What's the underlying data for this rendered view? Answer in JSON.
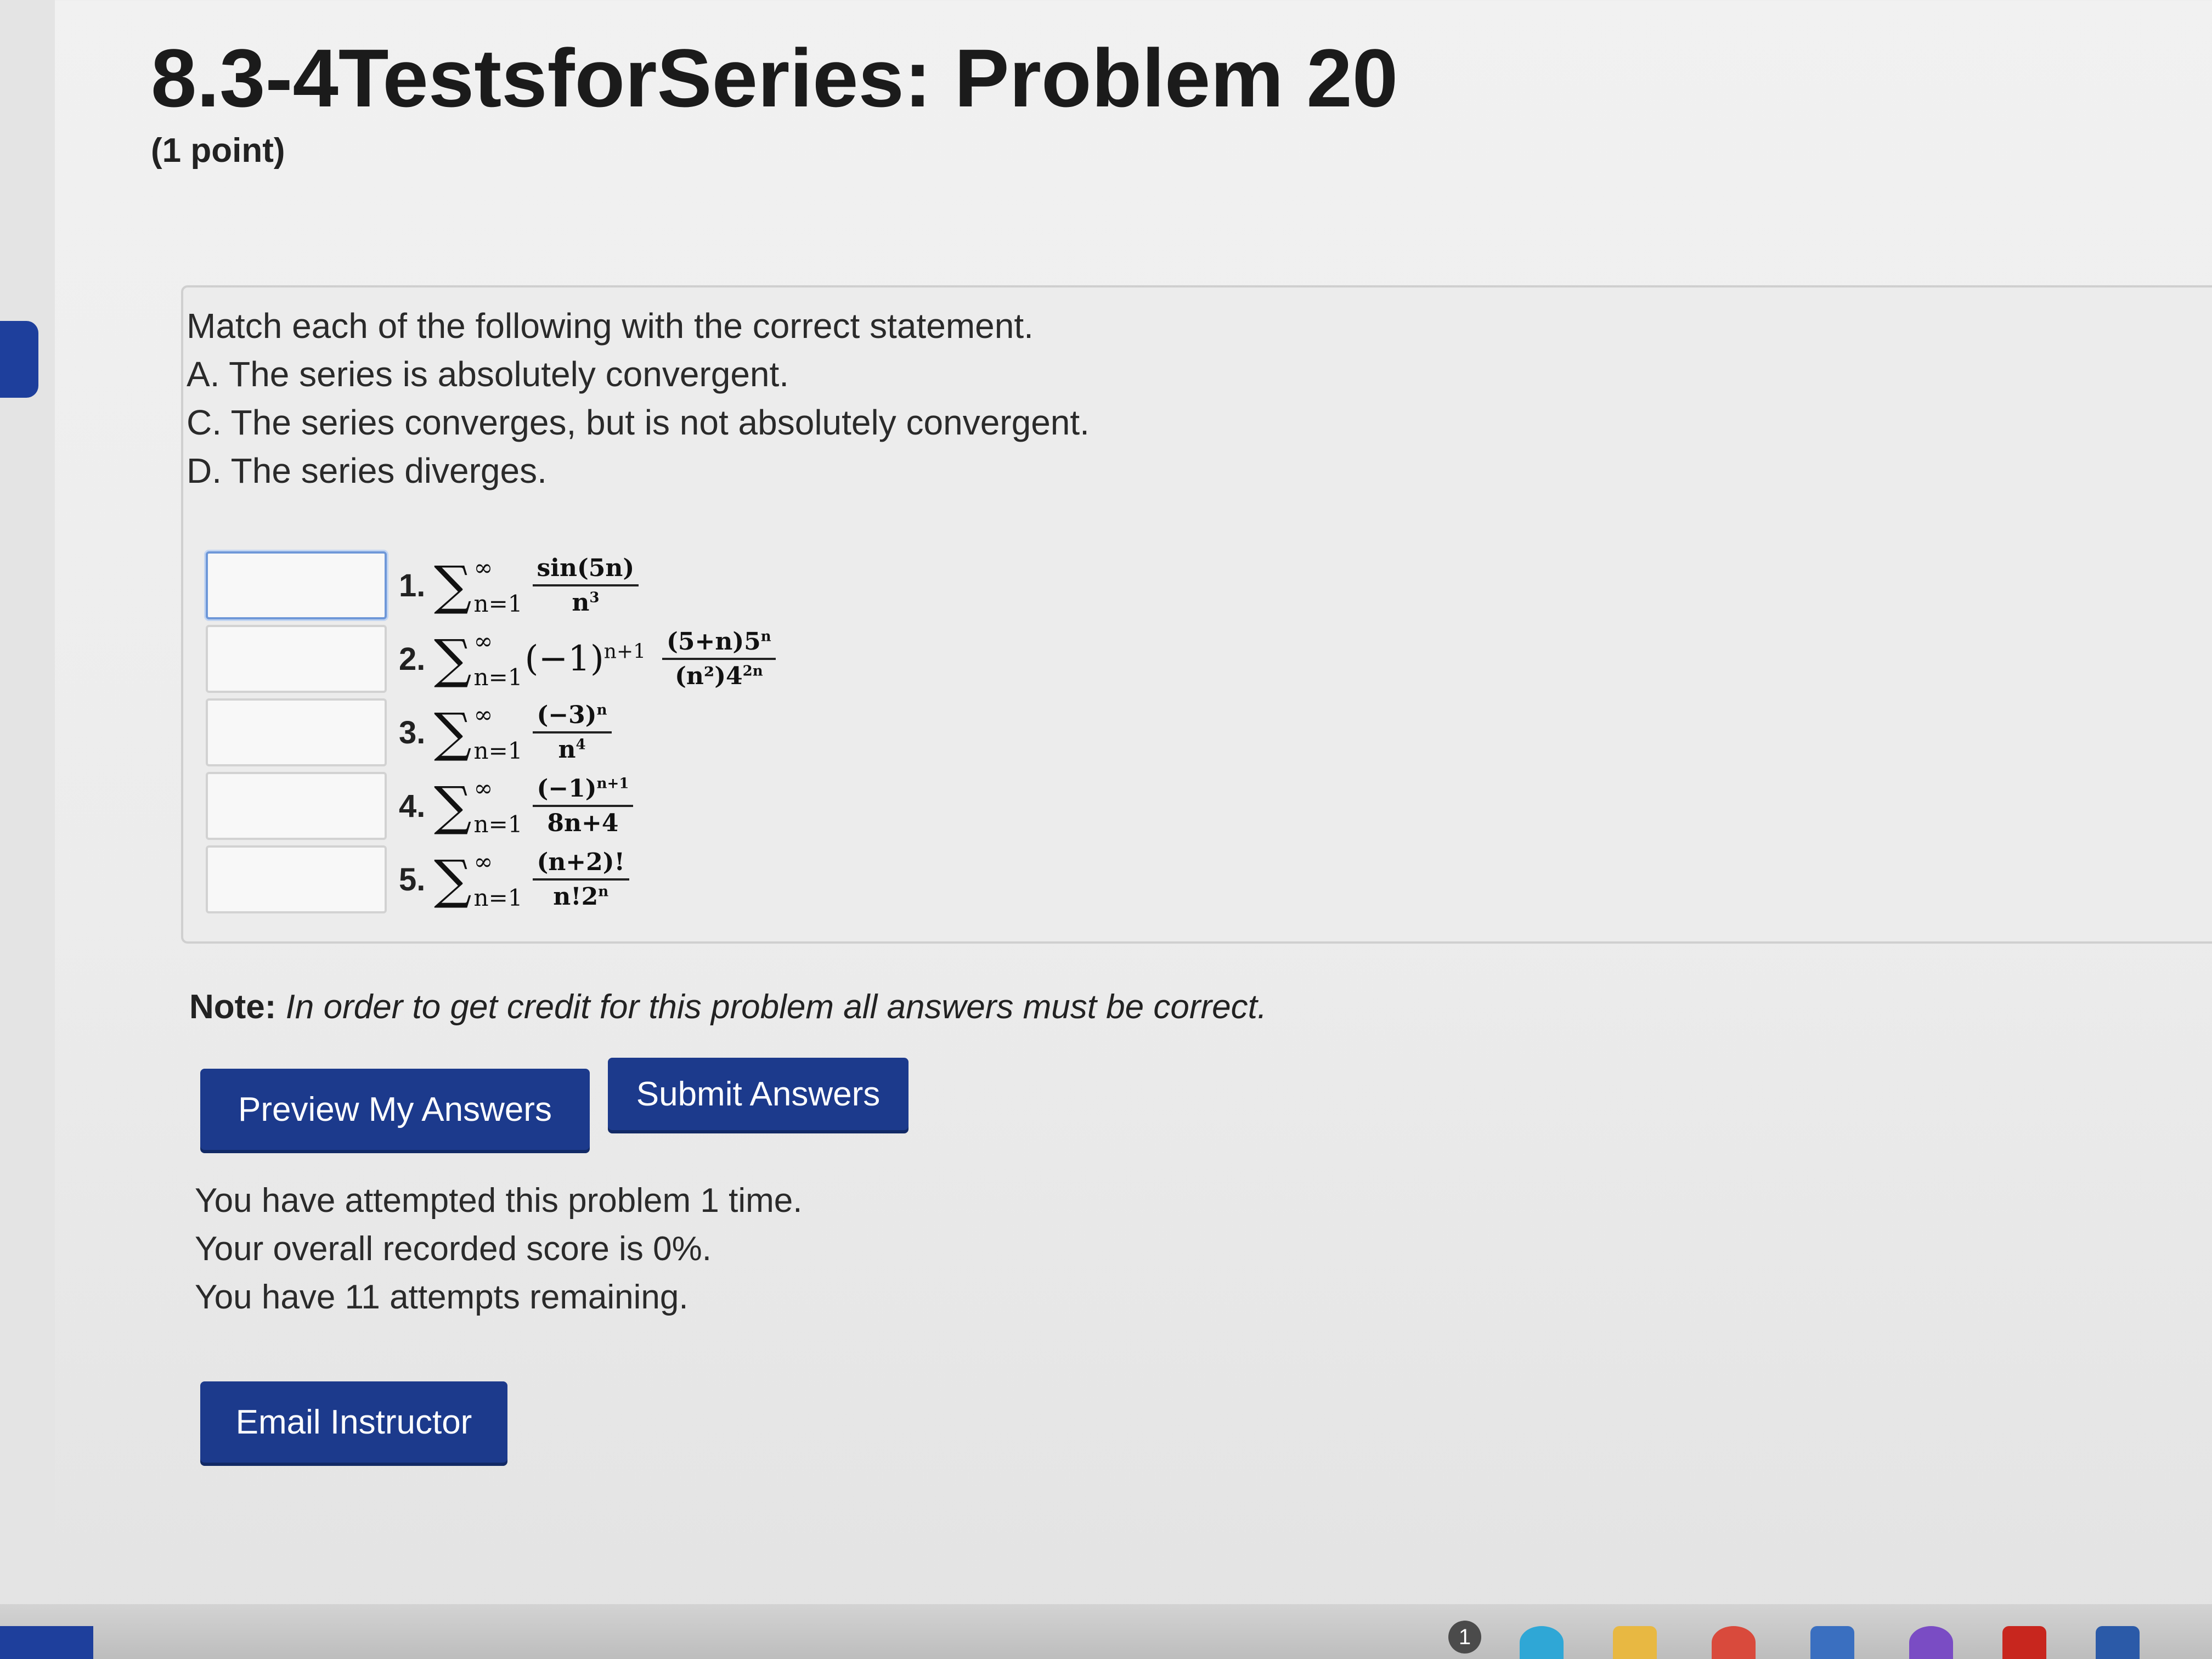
{
  "header": {
    "title": "8.3-4TestsforSeries: Problem 20",
    "points": "(1 point)"
  },
  "instructions": {
    "prompt": "Match each of the following with the correct statement.",
    "options": [
      "A. The series is absolutely convergent.",
      "C. The series converges, but is not absolutely convergent.",
      "D. The series diverges."
    ]
  },
  "problems": [
    {
      "number": "1.",
      "value": "",
      "sigma": "∑",
      "sup": "∞",
      "sub": "n=1",
      "factor": "",
      "factor_exp": "",
      "numerator": "sin(5n)",
      "num_exp": "",
      "denominator": "n",
      "den_exp": "3"
    },
    {
      "number": "2.",
      "value": "",
      "sigma": "∑",
      "sup": "∞",
      "sub": "n=1",
      "factor": "(−1)",
      "factor_exp": "n+1",
      "numerator": "(5+n)5",
      "num_exp": "n",
      "denominator": "(n²)4",
      "den_exp": "2n"
    },
    {
      "number": "3.",
      "value": "",
      "sigma": "∑",
      "sup": "∞",
      "sub": "n=1",
      "factor": "",
      "factor_exp": "",
      "numerator": "(−3)",
      "num_exp": "n",
      "denominator": "n",
      "den_exp": "4"
    },
    {
      "number": "4.",
      "value": "",
      "sigma": "∑",
      "sup": "∞",
      "sub": "n=1",
      "factor": "",
      "factor_exp": "",
      "numerator": "(−1)",
      "num_exp": "n+1",
      "denominator": "8n+4",
      "den_exp": ""
    },
    {
      "number": "5.",
      "value": "",
      "sigma": "∑",
      "sup": "∞",
      "sub": "n=1",
      "factor": "",
      "factor_exp": "",
      "numerator": "(n+2)!",
      "num_exp": "",
      "denominator": "n!2",
      "den_exp": "n"
    }
  ],
  "note": {
    "label": "Note:",
    "text": "In order to get credit for this problem all answers must be correct."
  },
  "buttons": {
    "preview": "Preview My Answers",
    "submit": "Submit Answers",
    "email": "Email Instructor"
  },
  "status": {
    "attempted": "You have attempted this problem 1 time.",
    "score": "Your overall recorded score is 0%.",
    "remaining": "You have 11 attempts remaining."
  },
  "taskbar": {
    "badge_count": "1",
    "icons": [
      "notification-badge-icon",
      "edge-browser-icon",
      "file-explorer-icon",
      "chrome-icon",
      "store-icon",
      "copilot-icon",
      "acrobat-icon",
      "word-icon"
    ]
  },
  "colors": {
    "button_bg": "#1c3a8c",
    "accent_tab": "#1e3f9c",
    "input_focus": "#6f98d8"
  }
}
